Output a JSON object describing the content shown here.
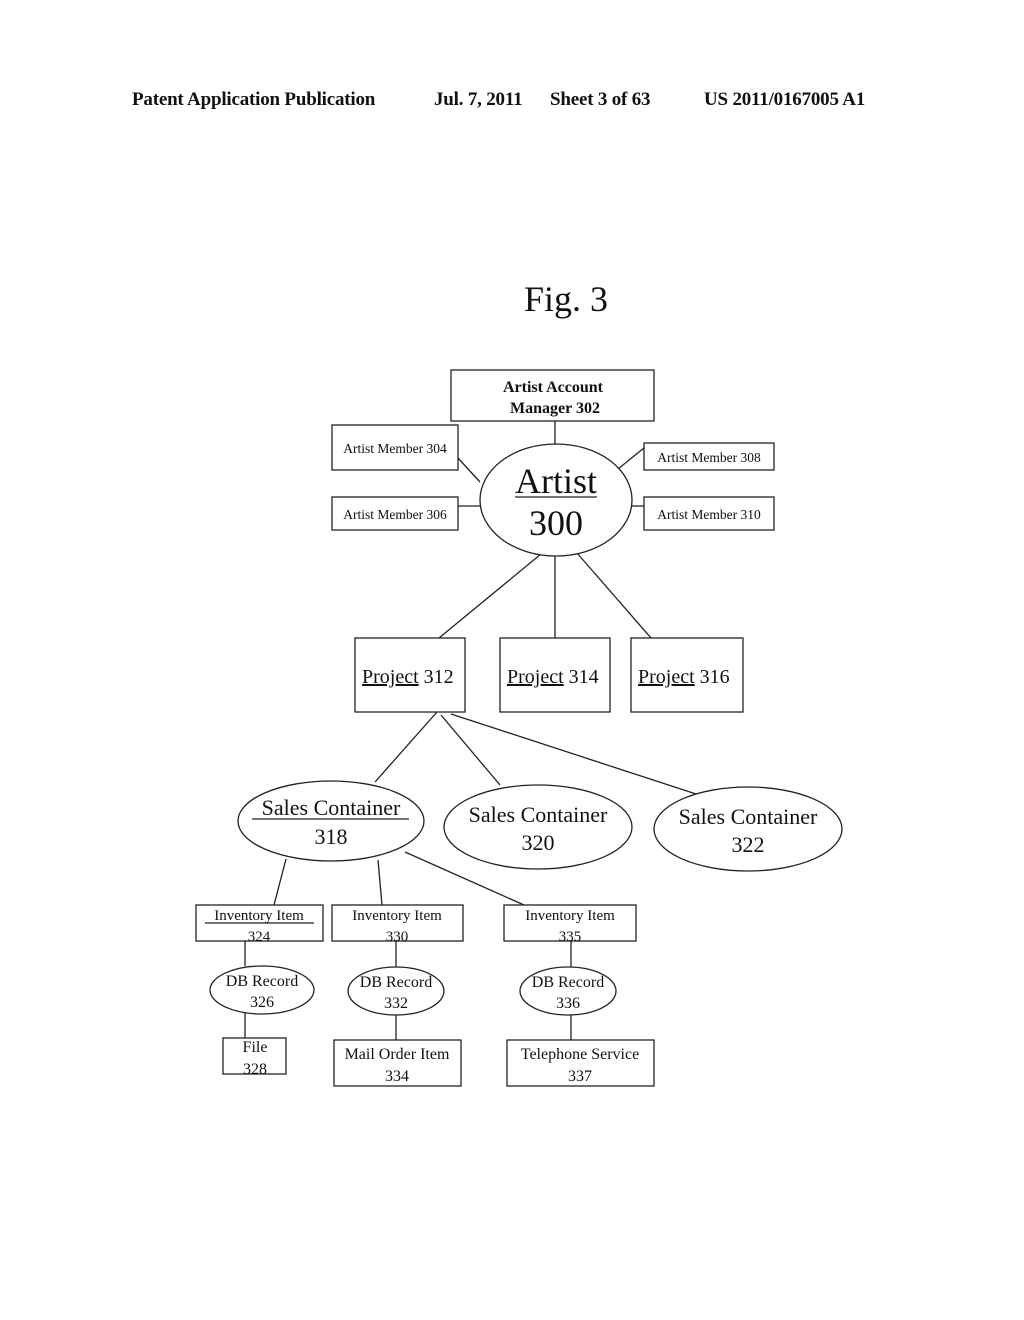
{
  "header": {
    "publication": "Patent Application Publication",
    "date": "Jul. 7, 2011",
    "sheet": "Sheet 3 of 63",
    "number": "US 2011/0167005 A1"
  },
  "figure": {
    "title": "Fig. 3"
  },
  "nodes": {
    "account_manager": {
      "line1": "Artist Account",
      "line2": "Manager 302",
      "shape": "box"
    },
    "artist": {
      "line1": "Artist",
      "line2": "300",
      "shape": "ellipse",
      "underlined": "line1"
    },
    "member_304": {
      "label": "Artist Member 304",
      "shape": "box"
    },
    "member_306": {
      "label": "Artist Member 306",
      "shape": "box"
    },
    "member_308": {
      "label": "Artist Member 308",
      "shape": "box"
    },
    "member_310": {
      "label": "Artist Member 310",
      "shape": "box"
    },
    "project_312": {
      "word": "Project",
      "num": "312",
      "shape": "box",
      "underlined": "word"
    },
    "project_314": {
      "word": "Project",
      "num": "314",
      "shape": "box",
      "underlined": "word"
    },
    "project_316": {
      "word": "Project",
      "num": "316",
      "shape": "box",
      "underlined": "word"
    },
    "sales_318": {
      "line1": "Sales Container",
      "line2": "318",
      "shape": "ellipse",
      "underlined": "line1"
    },
    "sales_320": {
      "line1": "Sales Container",
      "line2": "320",
      "shape": "ellipse"
    },
    "sales_322": {
      "line1": "Sales Container",
      "line2": "322",
      "shape": "ellipse"
    },
    "inv_324": {
      "line1": "Inventory Item",
      "line2": "324",
      "shape": "box",
      "underlined": "line1"
    },
    "inv_330": {
      "line1": "Inventory Item",
      "line2": "330",
      "shape": "box"
    },
    "inv_335": {
      "line1": "Inventory Item",
      "line2": "335",
      "shape": "box"
    },
    "db_326": {
      "line1": "DB Record",
      "line2": "326",
      "shape": "ellipse"
    },
    "db_332": {
      "line1": "DB Record",
      "line2": "332",
      "shape": "ellipse"
    },
    "db_336": {
      "line1": "DB Record",
      "line2": "336",
      "shape": "ellipse"
    },
    "file_328": {
      "line1": "File",
      "line2": "328",
      "shape": "box"
    },
    "mail_334": {
      "line1": "Mail Order Item",
      "line2": "334",
      "shape": "box"
    },
    "tel_337": {
      "line1": "Telephone Service",
      "line2": "337",
      "shape": "box"
    }
  },
  "edges": [
    [
      "account_manager",
      "artist"
    ],
    [
      "member_304",
      "artist"
    ],
    [
      "member_306",
      "artist"
    ],
    [
      "member_308",
      "artist"
    ],
    [
      "member_310",
      "artist"
    ],
    [
      "artist",
      "project_312"
    ],
    [
      "artist",
      "project_314"
    ],
    [
      "artist",
      "project_316"
    ],
    [
      "project_312",
      "sales_318"
    ],
    [
      "project_312",
      "sales_320"
    ],
    [
      "project_312",
      "sales_322"
    ],
    [
      "sales_318",
      "inv_324"
    ],
    [
      "sales_318",
      "inv_330"
    ],
    [
      "sales_318",
      "inv_335"
    ],
    [
      "inv_324",
      "db_326"
    ],
    [
      "inv_330",
      "db_332"
    ],
    [
      "inv_335",
      "db_336"
    ],
    [
      "db_326",
      "file_328"
    ],
    [
      "db_332",
      "mail_334"
    ],
    [
      "db_336",
      "tel_337"
    ]
  ]
}
